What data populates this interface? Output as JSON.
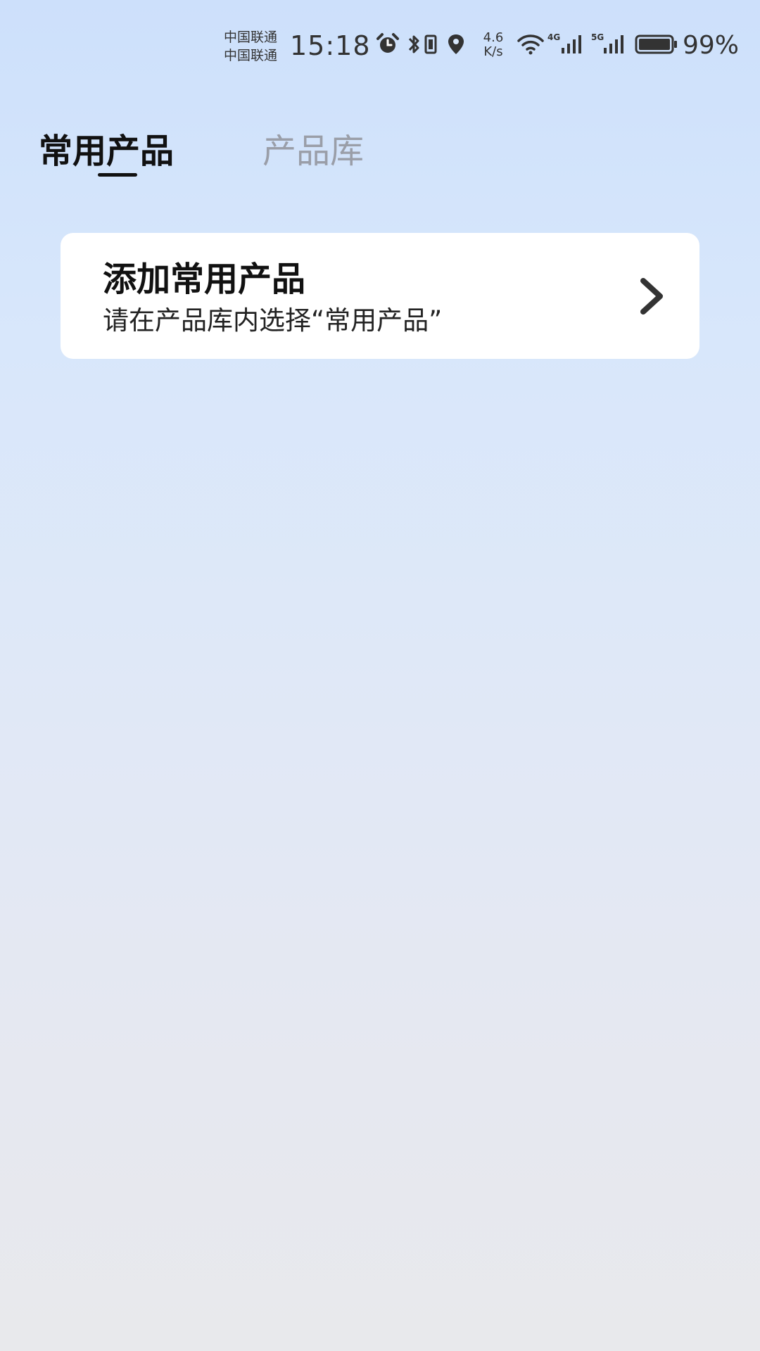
{
  "status_bar": {
    "carrier_1": "中国联通",
    "carrier_2": "中国联通",
    "time": "15:18",
    "net_speed_value": "4.6",
    "net_speed_unit": "K/s",
    "signal_1_tag": "4G",
    "signal_2_tag": "5G",
    "battery_percent": "99%",
    "icons": [
      "alarm-icon",
      "bluetooth-icon",
      "vibrate-icon",
      "location-icon",
      "wifi-icon",
      "signal-icon",
      "signal-icon",
      "battery-icon"
    ]
  },
  "tabs": [
    {
      "label": "常用产品",
      "active": true
    },
    {
      "label": "产品库",
      "active": false
    }
  ],
  "card": {
    "title": "添加常用产品",
    "subtitle": "请在产品库内选择“常用产品”",
    "icon": "chevron-right-icon"
  },
  "colors": {
    "text_primary": "#111111",
    "tab_inactive": "#9a9ea8",
    "card_bg": "#ffffff"
  }
}
